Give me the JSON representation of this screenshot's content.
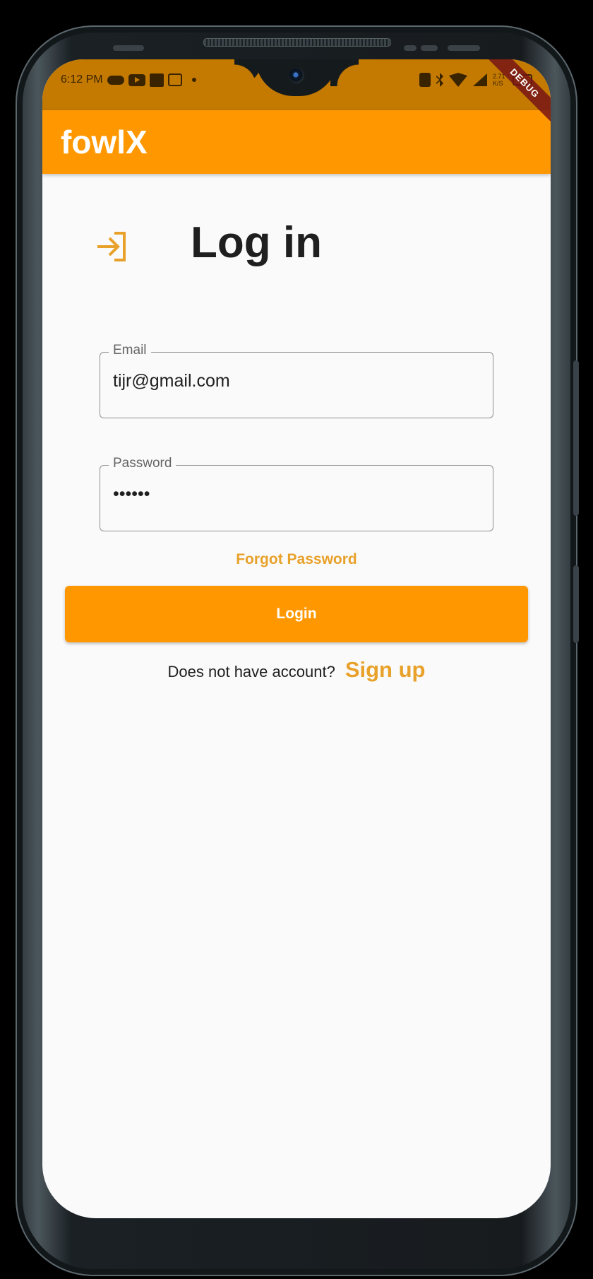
{
  "status_bar": {
    "time": "6:12 PM",
    "net_speed": "2.71 K/S",
    "icons_left": [
      "cloud-icon",
      "youtube-icon",
      "news-icon",
      "shirt-icon",
      "dot-icon"
    ],
    "icons_right": [
      "vibrate-icon",
      "bluetooth-icon",
      "wifi-icon",
      "signal-icon",
      "battery-icon"
    ],
    "color": "#c47a00"
  },
  "debug_banner": "DEBUG",
  "appbar": {
    "title": "fowlX",
    "color": "#ff9800"
  },
  "login": {
    "icon": "login-icon",
    "title": "Log in",
    "email": {
      "label": "Email",
      "value": "tijr@gmail.com"
    },
    "password": {
      "label": "Password",
      "value": "••••••"
    },
    "forgot_password": "Forgot Password",
    "login_button": "Login",
    "signup_prompt": "Does not have account?",
    "signup_link": "Sign up",
    "accent_color": "#e8a12a"
  }
}
